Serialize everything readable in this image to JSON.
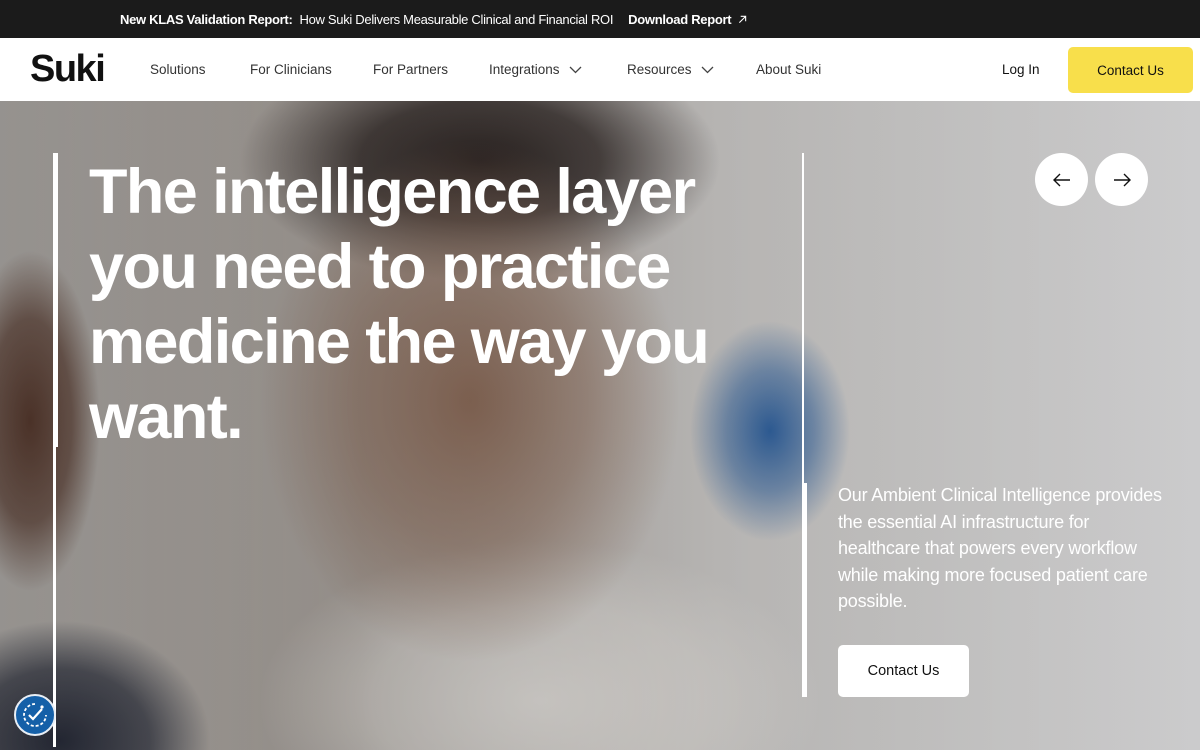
{
  "announcement": {
    "label": "New KLAS Validation Report:",
    "message": "How Suki Delivers Measurable Clinical and Financial ROI",
    "link": "Download Report",
    "link_icon": "arrow-up-right-icon"
  },
  "nav": {
    "logo": "Suki",
    "items": [
      {
        "label": "Solutions",
        "dropdown": false
      },
      {
        "label": "For Clinicians",
        "dropdown": false
      },
      {
        "label": "For Partners",
        "dropdown": false
      },
      {
        "label": "Integrations",
        "dropdown": true
      },
      {
        "label": "Resources",
        "dropdown": true
      },
      {
        "label": "About Suki",
        "dropdown": false
      }
    ],
    "login": "Log In",
    "contact": "Contact Us"
  },
  "hero": {
    "headline": "The intelligence layer you need to practice medicine the way you want.",
    "subtext": "Our Ambient Clinical Intelligence provides the essential AI infrastructure for healthcare that powers every workflow while making more focused patient care possible.",
    "cta": "Contact Us",
    "prev_icon": "arrow-left-icon",
    "next_icon": "arrow-right-icon"
  },
  "accessibility": {
    "icon": "accessibility-icon"
  },
  "colors": {
    "announcement_bg": "#1b1b1b",
    "accent_yellow": "#f8df4b",
    "a11y_blue": "#1560a8"
  }
}
